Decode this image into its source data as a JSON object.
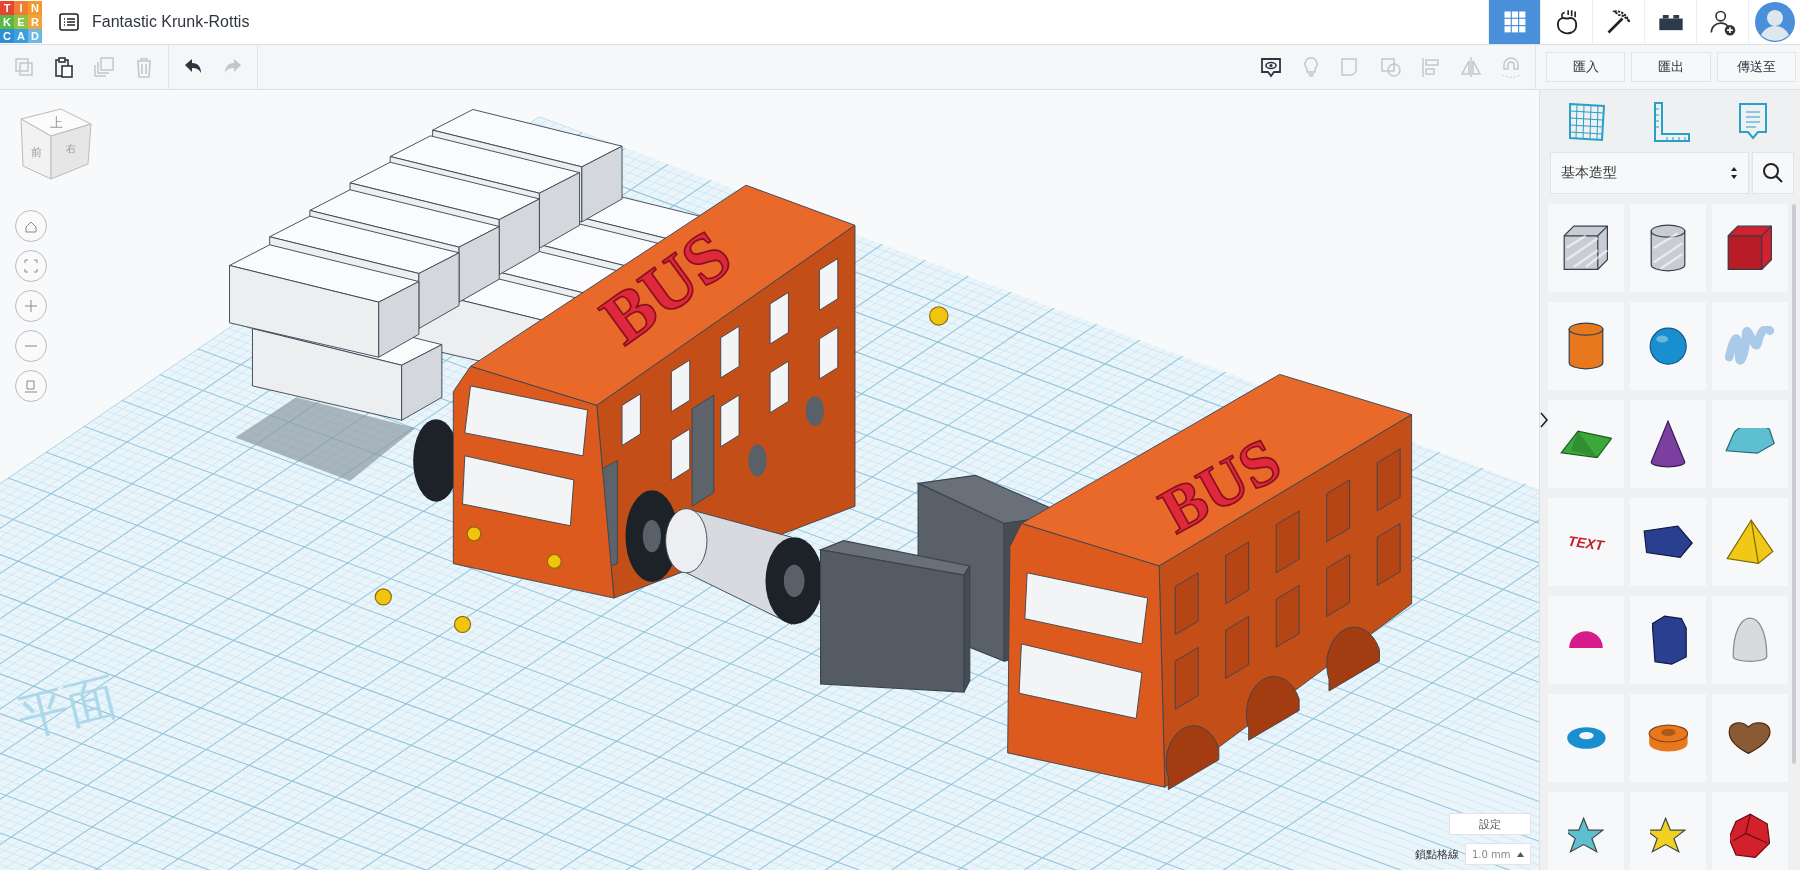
{
  "logo": {
    "letters": [
      {
        "char": "T",
        "color": "#e5462e"
      },
      {
        "char": "I",
        "color": "#ef7d32"
      },
      {
        "char": "N",
        "color": "#f39a2d"
      },
      {
        "char": "K",
        "color": "#58b947"
      },
      {
        "char": "E",
        "color": "#8bc441"
      },
      {
        "char": "R",
        "color": "#f0a33a"
      },
      {
        "char": "C",
        "color": "#2f8fd3"
      },
      {
        "char": "A",
        "color": "#3a9fde"
      },
      {
        "char": "D",
        "color": "#6cb7e6"
      }
    ]
  },
  "project_title": "Fantastic Krunk-Rottis",
  "top_tabs": [
    {
      "kind": "grid",
      "selected": true
    },
    {
      "kind": "apple",
      "selected": false
    },
    {
      "kind": "pickaxe",
      "selected": false
    },
    {
      "kind": "brick",
      "selected": false
    },
    {
      "kind": "add-user",
      "selected": false
    },
    {
      "kind": "avatar",
      "selected": false
    }
  ],
  "toolbar": {
    "edit_tools": [
      {
        "kind": "copy",
        "disabled": true
      },
      {
        "kind": "paste",
        "disabled": false
      },
      {
        "kind": "duplicate",
        "disabled": true
      },
      {
        "kind": "delete",
        "disabled": true
      }
    ],
    "history": [
      {
        "kind": "undo",
        "disabled": false
      },
      {
        "kind": "redo",
        "disabled": true
      }
    ],
    "view_tools": [
      {
        "kind": "notes",
        "disabled": false
      },
      {
        "kind": "light",
        "disabled": true
      },
      {
        "kind": "shape",
        "disabled": true
      },
      {
        "kind": "hole",
        "disabled": true
      },
      {
        "kind": "align",
        "disabled": true
      },
      {
        "kind": "mirror",
        "disabled": true
      },
      {
        "kind": "magnet",
        "disabled": true
      }
    ],
    "actions": [
      "匯入",
      "匯出",
      "傳送至"
    ]
  },
  "view_cube": {
    "top": "上",
    "front": "前",
    "right": "右"
  },
  "view_controls": [
    {
      "kind": "home"
    },
    {
      "kind": "fit"
    },
    {
      "kind": "zoom-in"
    },
    {
      "kind": "zoom-out"
    },
    {
      "kind": "ortho"
    }
  ],
  "workplane": {
    "label": "平面"
  },
  "scene": {
    "buses": [
      {
        "lettering": "BUS"
      },
      {
        "lettering": "BUS"
      }
    ]
  },
  "library": {
    "tools": [
      {
        "kind": "grid"
      },
      {
        "kind": "ruler"
      },
      {
        "kind": "notes"
      }
    ],
    "category": "基本造型",
    "shapes": [
      {
        "kind": "box-hole",
        "color": "#c9ccd3"
      },
      {
        "kind": "cylinder-hole",
        "color": "#c9ccd3"
      },
      {
        "kind": "box",
        "color": "#d2202c"
      },
      {
        "kind": "cylinder",
        "color": "#e8781e"
      },
      {
        "kind": "sphere",
        "color": "#1a8fd0"
      },
      {
        "kind": "scribble",
        "color": "#a9cbe8"
      },
      {
        "kind": "roof",
        "color": "#3aa83a"
      },
      {
        "kind": "cone",
        "color": "#7b3fa0"
      },
      {
        "kind": "round-roof",
        "color": "#5ebfd0"
      },
      {
        "kind": "text",
        "color": "#c4202c",
        "label": "TEXT"
      },
      {
        "kind": "polygon",
        "color": "#2a3f8f"
      },
      {
        "kind": "pyramid",
        "color": "#f0c818"
      },
      {
        "kind": "half-sphere",
        "color": "#d81b8a"
      },
      {
        "kind": "prism",
        "color": "#2a3f8f"
      },
      {
        "kind": "paraboloid",
        "color": "#d8dadd"
      },
      {
        "kind": "torus",
        "color": "#1a8fd0"
      },
      {
        "kind": "tube",
        "color": "#e8781e"
      },
      {
        "kind": "heart",
        "color": "#8a5a34"
      },
      {
        "kind": "star",
        "color": "#5ebfd0"
      },
      {
        "kind": "star-flat",
        "color": "#f0d020"
      },
      {
        "kind": "icosahedron",
        "color": "#d2202c"
      }
    ]
  },
  "grid_settings": {
    "settings_button": "設定",
    "snap_label": "鎖點格線",
    "snap_value": "1.0 mm"
  }
}
